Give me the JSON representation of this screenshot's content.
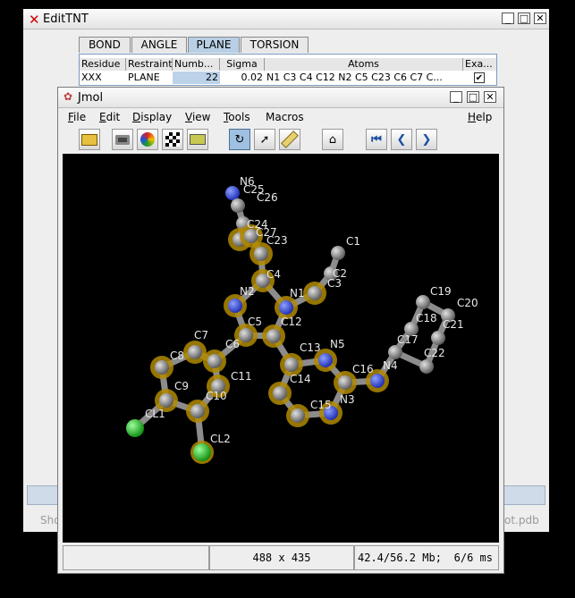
{
  "edittnt": {
    "title": "EditTNT",
    "tabs": [
      {
        "label": "BOND",
        "active": false
      },
      {
        "label": "ANGLE",
        "active": false
      },
      {
        "label": "PLANE",
        "active": true
      },
      {
        "label": "TORSION",
        "active": false
      }
    ],
    "table": {
      "headers": [
        "Residue",
        "Restraint",
        "Numb...",
        "Sigma",
        "Atoms",
        "Exa..."
      ],
      "rows": [
        {
          "residue": "XXX",
          "restraint": "PLANE",
          "number": "22",
          "sigma": "0.02",
          "atoms": "N1 C3 C4 C12 N2 C5 C23 C6 C7 C...",
          "example_checked": true
        }
      ]
    },
    "footer_left": "Sho",
    "footer_right": "ot.pdb"
  },
  "jmol": {
    "title": "Jmol",
    "menu": [
      {
        "label": "File",
        "u": "F",
        "rest": "ile"
      },
      {
        "label": "Edit",
        "u": "E",
        "rest": "dit"
      },
      {
        "label": "Display",
        "u": "D",
        "rest": "isplay"
      },
      {
        "label": "View",
        "u": "V",
        "rest": "iew"
      },
      {
        "label": "Tools",
        "u": "T",
        "rest": "ools"
      },
      {
        "label": "Macros",
        "u": "",
        "rest": "Macros"
      },
      {
        "label": "Help",
        "u": "H",
        "rest": "elp"
      }
    ],
    "toolbar_icons": [
      "open-icon",
      "camera-icon",
      "globe-icon",
      "checker-icon",
      "print-icon",
      "rotate-icon",
      "pointer-icon",
      "ruler-icon",
      "home-icon",
      "first-frame-icon",
      "prev-frame-icon",
      "next-frame-icon"
    ],
    "status": {
      "size": "488 x 435",
      "memory": "42.4/56.2 Mb;",
      "timing": "6/6 ms"
    },
    "atoms": [
      "N6",
      "C25",
      "C26",
      "C24",
      "C27",
      "C23",
      "C1",
      "C4",
      "C2",
      "N2",
      "N1",
      "C3",
      "C5",
      "C12",
      "C7",
      "C6",
      "C13",
      "N5",
      "C8",
      "C11",
      "C16",
      "N4",
      "C14",
      "C9",
      "C10",
      "N3",
      "C15",
      "CL1",
      "CL2",
      "C19",
      "C20",
      "C18",
      "C21",
      "C17",
      "C22"
    ]
  },
  "colors": {
    "background": "#000000",
    "carbon": "#9a9a9a",
    "nitrogen": "#3a55ff",
    "chlorine": "#22cc22",
    "selection_halo": "#c8a000",
    "tab_active": "#b8cfe5"
  }
}
